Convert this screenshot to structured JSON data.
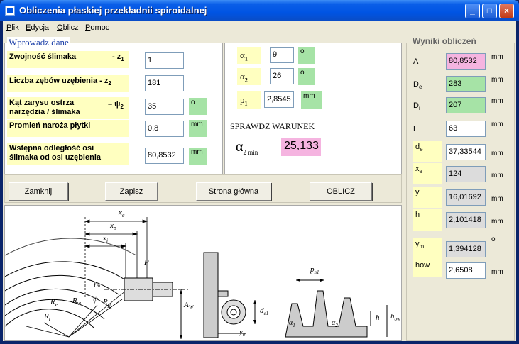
{
  "window": {
    "title": "Obliczenia płaskiej przekładnii spiroidalnej",
    "buttons": {
      "minimize": "_",
      "maximize": "□",
      "close": "×"
    }
  },
  "menu": [
    {
      "label": "Plik",
      "key": "P",
      "rest": "lik"
    },
    {
      "label": "Edycja",
      "key": "E",
      "rest": "dycja"
    },
    {
      "label": "Oblicz",
      "key": "O",
      "rest": "blicz"
    },
    {
      "label": "Pomoc",
      "key": "P",
      "rest": "omoc"
    }
  ],
  "input_group": {
    "title": "Wprowadz dane",
    "z1_label": "Zwojność ślimaka",
    "z1_symbol": "- z",
    "z1_sub": "1",
    "z1_value": "1",
    "z2_label": "Liczba zębów uzębienia - z",
    "z2_sub": "2",
    "z2_value": "181",
    "psi2_label_line1": "Kąt zarysu ostrza",
    "psi2_label_line2": "narzędzia / ślimaka",
    "psi2_symbol": "– ψ",
    "psi2_sub": "2",
    "psi2_value": "35",
    "psi2_unit": "o",
    "radius_label": "Promień naroża płytki",
    "radius_value": "0,8",
    "radius_unit": "mm",
    "distance_label_line1": "Wstępna odległość osi",
    "distance_label_line2": "ślimaka od osi uzębienia",
    "distance_value": "80,8532",
    "distance_unit": "mm"
  },
  "params": {
    "alpha1_symbol": "α",
    "alpha1_sub": "1",
    "alpha1_value": "9",
    "alpha1_unit": "o",
    "alpha2_symbol": "α",
    "alpha2_sub": "2",
    "alpha2_value": "26",
    "alpha2_unit": "o",
    "p1_symbol": "p",
    "p1_sub": "1",
    "p1_value": "2,8545",
    "p1_unit": "mm",
    "check_label": "SPRAWDZ WARUNEK",
    "alpha2min_symbol": "α",
    "alpha2min_sub": "2 min",
    "alpha2min_value": "25,133"
  },
  "buttons": {
    "close": "Zamknij",
    "save": "Zapisz",
    "home": "Strona główna",
    "calculate": "OBLICZ"
  },
  "results": {
    "title": "Wyniki obliczeń",
    "items": [
      {
        "label": "A",
        "sub": "",
        "value": "80,8532",
        "unit": "mm"
      },
      {
        "label": "D",
        "sub": "e",
        "value": "283",
        "unit": "mm"
      },
      {
        "label": "D",
        "sub": "i",
        "value": "207",
        "unit": "mm"
      },
      {
        "label": "L",
        "sub": "",
        "value": "63",
        "unit": "mm"
      },
      {
        "label": "d",
        "sub": "e",
        "value": "37,33544",
        "unit": "mm"
      },
      {
        "label": "x",
        "sub": "e",
        "value": "124",
        "unit": "mm"
      },
      {
        "label": "y",
        "sub": "i",
        "value": "16,01692",
        "unit": "mm"
      },
      {
        "label": "h",
        "sub": "",
        "value": "2,101418",
        "unit": "mm"
      },
      {
        "label": "γ",
        "sub": "m",
        "value": "1,394128",
        "unit": "o"
      },
      {
        "label": "how",
        "sub": "",
        "value": "2,6508",
        "unit": "mm"
      }
    ]
  },
  "diagram": {
    "labels": {
      "xe": "x",
      "xe_sub": "e",
      "xp": "x",
      "xp_sub": "p",
      "xi": "x",
      "xi_sub": "i",
      "P": "P",
      "gm": "γ",
      "gm_sub": "m",
      "Re": "R",
      "Re_sub": "e",
      "Rw": "R",
      "Rw_sub": "w",
      "psi": "ψ",
      "Rp": "R",
      "Rp_sub": "p",
      "Ri": "R",
      "Ri_sub": "i",
      "Aw": "A",
      "Aw_sub": "W",
      "de1": "d",
      "de1_sub": "e1",
      "ye": "y",
      "ye_sub": "e",
      "pn1": "p",
      "pn1_sub": "n1",
      "h": "h",
      "how": "h",
      "how_sub": "ow",
      "a1": "α",
      "a1_sub": "1",
      "a2": "α",
      "a2_sub": "2"
    }
  }
}
